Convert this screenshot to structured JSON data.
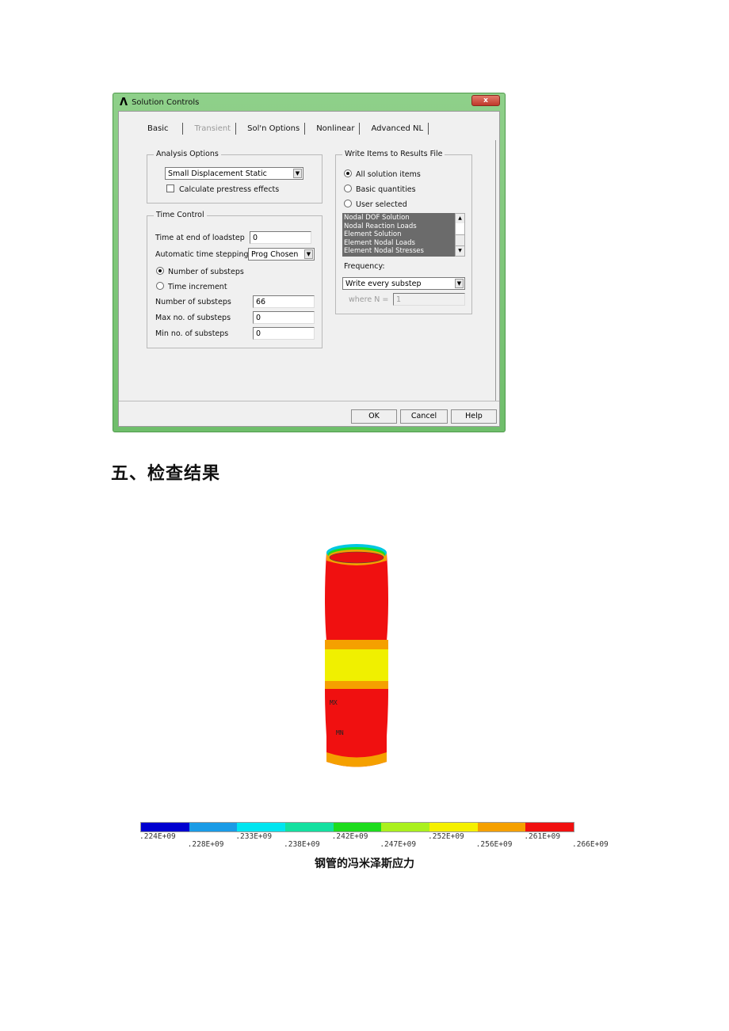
{
  "dialog": {
    "title": "Solution Controls",
    "logo_glyph": "Λ",
    "close_glyph": "x",
    "tabs": [
      {
        "label": "Basic",
        "enabled": true,
        "active": true
      },
      {
        "label": "Transient",
        "enabled": false,
        "active": false
      },
      {
        "label": "Sol'n Options",
        "enabled": true,
        "active": false
      },
      {
        "label": "Nonlinear",
        "enabled": true,
        "active": false
      },
      {
        "label": "Advanced NL",
        "enabled": true,
        "active": false
      }
    ],
    "analysis_options": {
      "title": "Analysis Options",
      "analysis_type": "Small Displacement Static",
      "prestress_label": "Calculate prestress effects",
      "prestress_checked": false
    },
    "time_control": {
      "title": "Time Control",
      "time_end_label": "Time at end of loadstep",
      "time_end_value": "0",
      "auto_step_label": "Automatic time stepping",
      "auto_step_value": "Prog Chosen",
      "radio_substeps_label": "Number of substeps",
      "radio_time_inc_label": "Time increment",
      "selected_mode": "Number of substeps",
      "num_substeps_label": "Number of substeps",
      "num_substeps_value": "66",
      "max_substeps_label": "Max no. of substeps",
      "max_substeps_value": "0",
      "min_substeps_label": "Min no. of substeps",
      "min_substeps_value": "0"
    },
    "write_items": {
      "title": "Write Items to Results File",
      "options": [
        "All solution items",
        "Basic quantities",
        "User selected"
      ],
      "selected": "All solution items",
      "list_items": [
        "Nodal DOF Solution",
        "Nodal Reaction Loads",
        "Element Solution",
        "Element Nodal Loads",
        "Element Nodal Stresses"
      ],
      "frequency_label": "Frequency:",
      "frequency_value": "Write every substep",
      "where_n_label": "where N =",
      "where_n_value": "1"
    },
    "buttons": {
      "ok": "OK",
      "cancel": "Cancel",
      "help": "Help"
    },
    "arrow_down": "▼",
    "arrow_up": "▲"
  },
  "section_heading": "五、检查结果",
  "contour": {
    "max_label": "MX",
    "min_label": "MN",
    "legend_colors": [
      "#0000d0",
      "#1a9be6",
      "#00e5f0",
      "#14e0a0",
      "#1edc1e",
      "#aaf01e",
      "#f5f000",
      "#f5a000",
      "#f01010"
    ],
    "legend_ticks": [
      ".224E+09",
      ".228E+09",
      ".233E+09",
      ".238E+09",
      ".242E+09",
      ".247E+09",
      ".252E+09",
      ".256E+09",
      ".261E+09",
      ".266E+09"
    ],
    "caption": "钢管的冯米泽斯应力"
  }
}
